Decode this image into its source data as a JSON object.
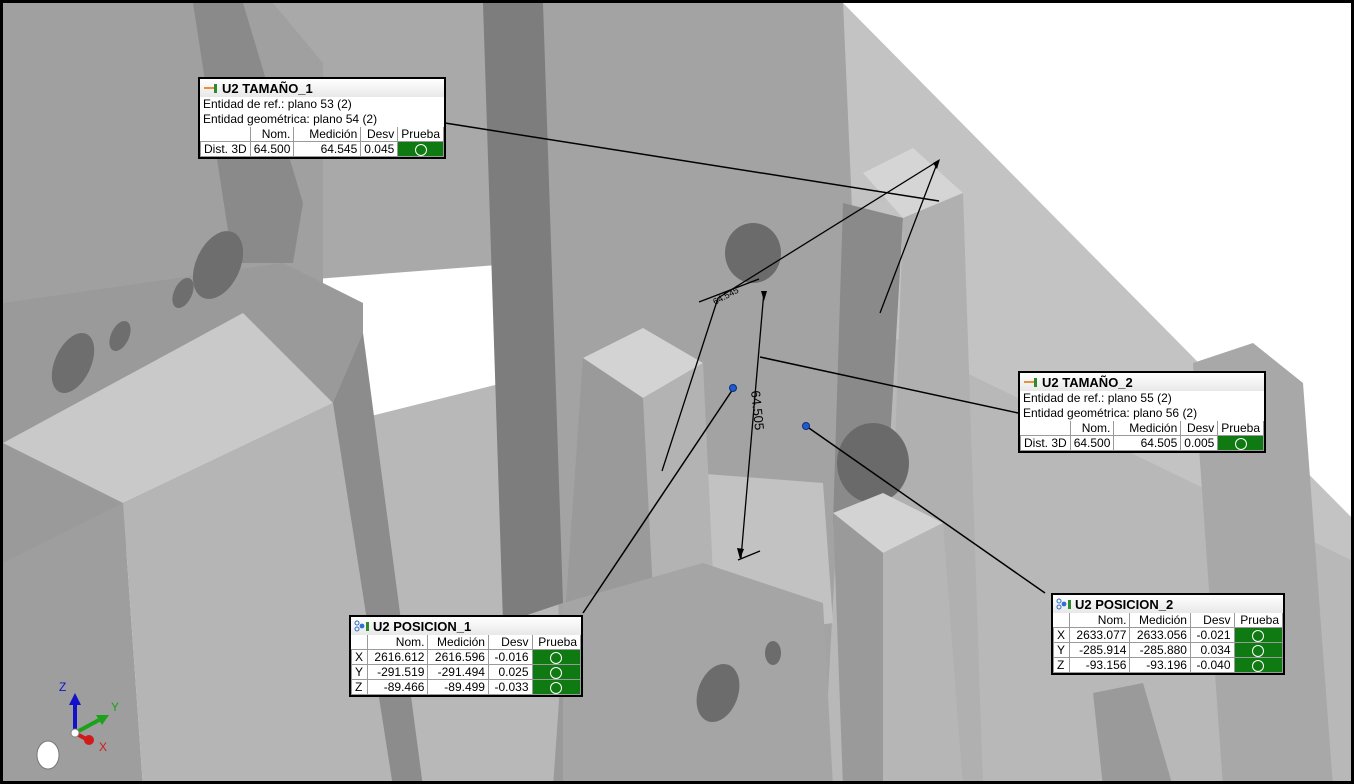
{
  "viewer": {
    "background": "#ffffff",
    "part_color": "#a7a7a7",
    "pass_color": "#0f7a12"
  },
  "dimension_labels": {
    "main": "64.505",
    "small": "64.545"
  },
  "axis_triad": {
    "z": "Z",
    "y": "Y",
    "x": "X"
  },
  "callouts": {
    "size1": {
      "title": "U2 TAMAÑO_1",
      "icon": "size-dimension-icon",
      "ref_entity": "Entidad de ref.: plano 53 (2)",
      "geom_entity": "Entidad geométrica: plano 54 (2)",
      "columns": [
        "Nom.",
        "Medición",
        "Desv",
        "Prueba"
      ],
      "rows": [
        {
          "label": "Dist. 3D",
          "nom": "64.500",
          "meas": "64.545",
          "dev": "0.045",
          "test": "pass"
        }
      ]
    },
    "size2": {
      "title": "U2 TAMAÑO_2",
      "icon": "size-dimension-icon",
      "ref_entity": "Entidad de ref.: plano 55 (2)",
      "geom_entity": "Entidad geométrica: plano 56 (2)",
      "columns": [
        "Nom.",
        "Medición",
        "Desv",
        "Prueba"
      ],
      "rows": [
        {
          "label": "Dist. 3D",
          "nom": "64.500",
          "meas": "64.505",
          "dev": "0.005",
          "test": "pass"
        }
      ]
    },
    "pos1": {
      "title": "U2 POSICION_1",
      "icon": "position-icon",
      "columns": [
        "Nom.",
        "Medición",
        "Desv",
        "Prueba"
      ],
      "rows": [
        {
          "label": "X",
          "nom": "2616.612",
          "meas": "2616.596",
          "dev": "-0.016",
          "test": "pass"
        },
        {
          "label": "Y",
          "nom": "-291.519",
          "meas": "-291.494",
          "dev": "0.025",
          "test": "pass"
        },
        {
          "label": "Z",
          "nom": "-89.466",
          "meas": "-89.499",
          "dev": "-0.033",
          "test": "pass"
        }
      ]
    },
    "pos2": {
      "title": "U2 POSICION_2",
      "icon": "position-icon",
      "columns": [
        "Nom.",
        "Medición",
        "Desv",
        "Prueba"
      ],
      "rows": [
        {
          "label": "X",
          "nom": "2633.077",
          "meas": "2633.056",
          "dev": "-0.021",
          "test": "pass"
        },
        {
          "label": "Y",
          "nom": "-285.914",
          "meas": "-285.880",
          "dev": "0.034",
          "test": "pass"
        },
        {
          "label": "Z",
          "nom": "-93.156",
          "meas": "-93.196",
          "dev": "-0.040",
          "test": "pass"
        }
      ]
    }
  }
}
